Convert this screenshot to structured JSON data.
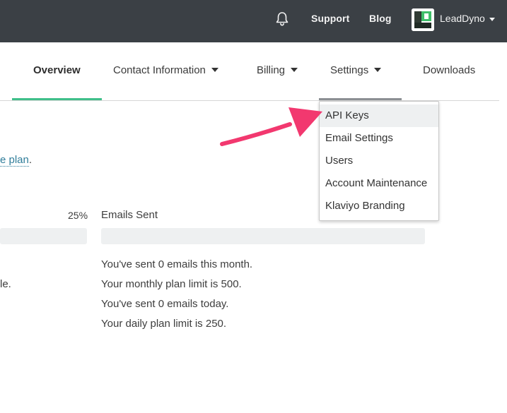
{
  "topbar": {
    "support_label": "Support",
    "blog_label": "Blog",
    "account_name": "LeadDyno",
    "icons": {
      "notifications": "bell-icon",
      "account_menu": "chevron-down-icon"
    }
  },
  "tabs": [
    {
      "label": "Overview",
      "active": true
    },
    {
      "label": "Contact Information",
      "has_dropdown": true
    },
    {
      "label": "Billing",
      "has_dropdown": true
    },
    {
      "label": "Settings",
      "has_dropdown": true,
      "open": true
    },
    {
      "label": "Downloads"
    }
  ],
  "settings_menu": {
    "items": [
      {
        "label": "API Keys",
        "highlighted": true
      },
      {
        "label": "Email Settings"
      },
      {
        "label": "Users"
      },
      {
        "label": "Account Maintenance"
      },
      {
        "label": "Klaviyo Branding"
      }
    ]
  },
  "content": {
    "plan_link_text": "e plan",
    "plan_period": ".",
    "left_usage_percent": "25%",
    "left_usage_value": 0.25,
    "left_fragment": "le.",
    "emails": {
      "title": "Emails Sent",
      "progress": 0,
      "lines": [
        "You've sent 0 emails this month.",
        "Your monthly plan limit is 500.",
        "You've sent 0 emails today.",
        "Your daily plan limit is 250."
      ]
    }
  },
  "colors": {
    "topbar_bg": "#3b4045",
    "active_tab_underline": "#3fbf8a",
    "link": "#2f7d9a",
    "annotation_arrow": "#f2386f",
    "menu_highlight": "#eef0f1"
  }
}
